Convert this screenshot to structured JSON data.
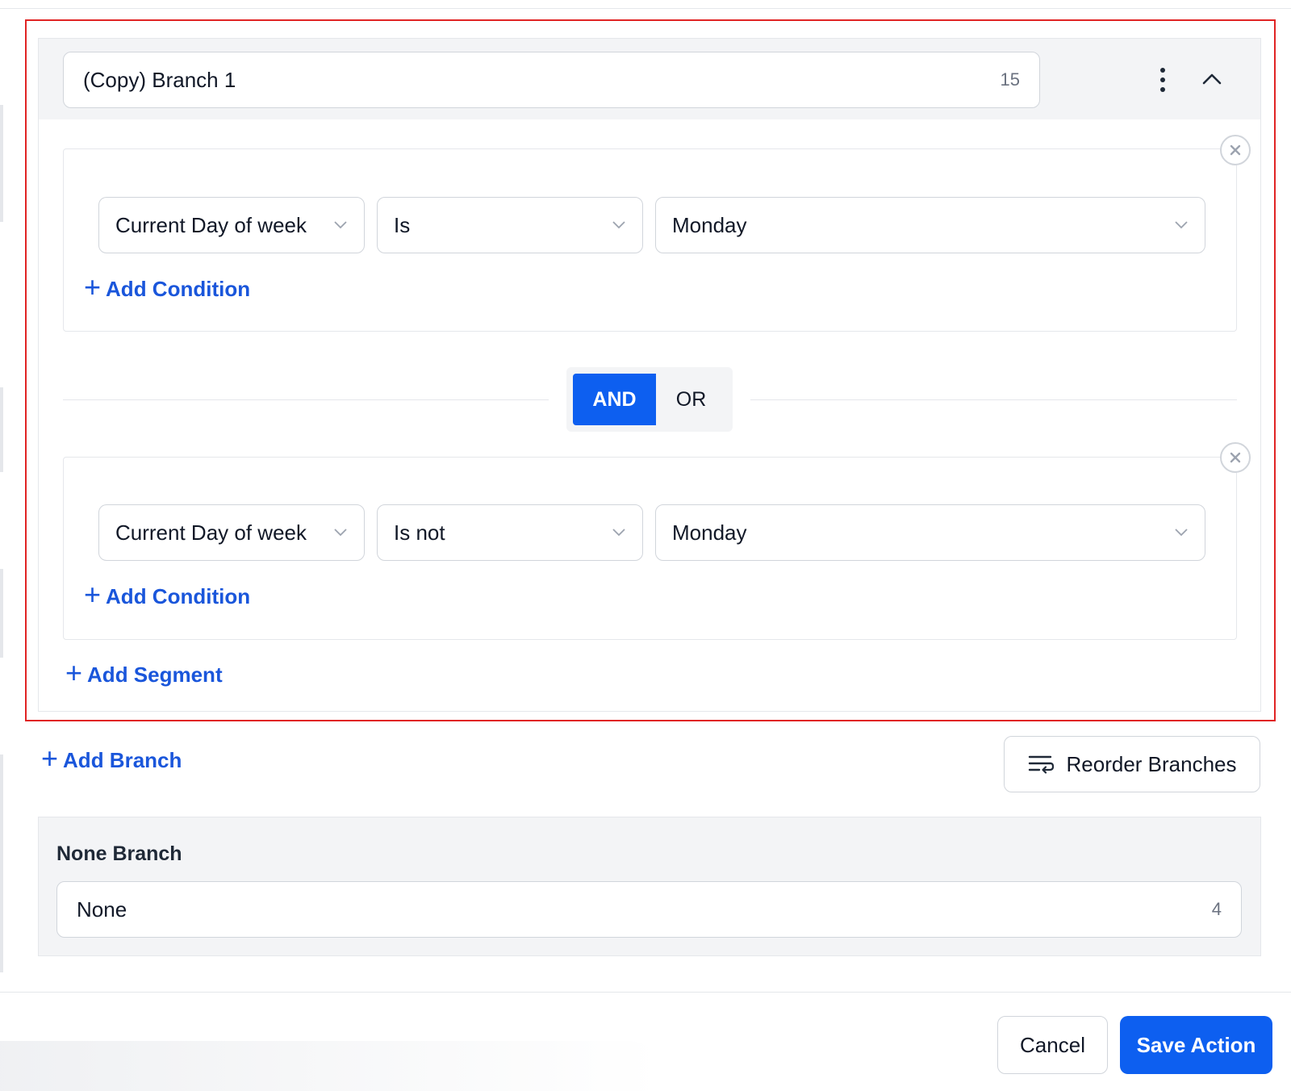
{
  "branch": {
    "name": "(Copy) Branch 1",
    "name_count": "15"
  },
  "segments": [
    {
      "field": "Current Day of week",
      "operator": "Is",
      "value": "Monday",
      "add_condition_label": "Add Condition"
    },
    {
      "field": "Current Day of week",
      "operator": "Is not",
      "value": "Monday",
      "add_condition_label": "Add Condition"
    }
  ],
  "logic_toggle": {
    "and_label": "AND",
    "or_label": "OR",
    "selected": "AND"
  },
  "add_segment_label": "Add Segment",
  "add_branch_label": "Add Branch",
  "reorder_label": "Reorder Branches",
  "none_branch": {
    "title": "None Branch",
    "name": "None",
    "count": "4"
  },
  "footer": {
    "cancel_label": "Cancel",
    "save_label": "Save Action"
  },
  "colors": {
    "primary": "#0d5ff0",
    "link": "#1a56db",
    "highlight": "#e02424"
  }
}
